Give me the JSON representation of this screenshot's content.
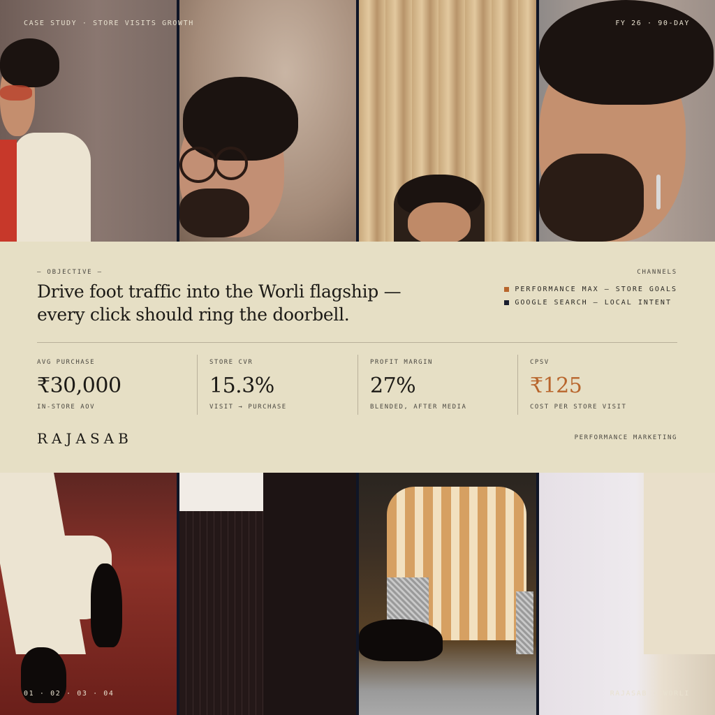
{
  "header": {
    "left": "CASE STUDY · STORE VISITS GROWTH",
    "right": "FY 26 · 90-DAY"
  },
  "footer": {
    "left": "01 · 02 · 03 · 04",
    "right": "RAJASAB · WORLI"
  },
  "objective": {
    "eyebrow": "— OBJECTIVE —",
    "line1": "Drive foot traffic into the Worli flagship —",
    "line2": "every click should ring the doorbell."
  },
  "channels": {
    "label": "CHANNELS",
    "items": [
      {
        "label": "PERFORMANCE MAX — STORE GOALS",
        "color": "#b8652c"
      },
      {
        "label": "GOOGLE SEARCH — LOCAL INTENT",
        "color": "#1a1e2e"
      }
    ]
  },
  "metrics": [
    {
      "label": "AVG PURCHASE",
      "value": "₹30,000",
      "sub": "IN-STORE AOV"
    },
    {
      "label": "STORE CVR",
      "value": "15.3%",
      "sub": "VISIT → PURCHASE"
    },
    {
      "label": "PROFIT MARGIN",
      "value": "27%",
      "sub": "BLENDED, AFTER MEDIA"
    },
    {
      "label": "CPSV",
      "value": "₹125",
      "sub": "COST PER STORE VISIT",
      "accent": "#b8652c"
    }
  ],
  "brand": "RAJASAB",
  "tagline": "PERFORMANCE MARKETING"
}
